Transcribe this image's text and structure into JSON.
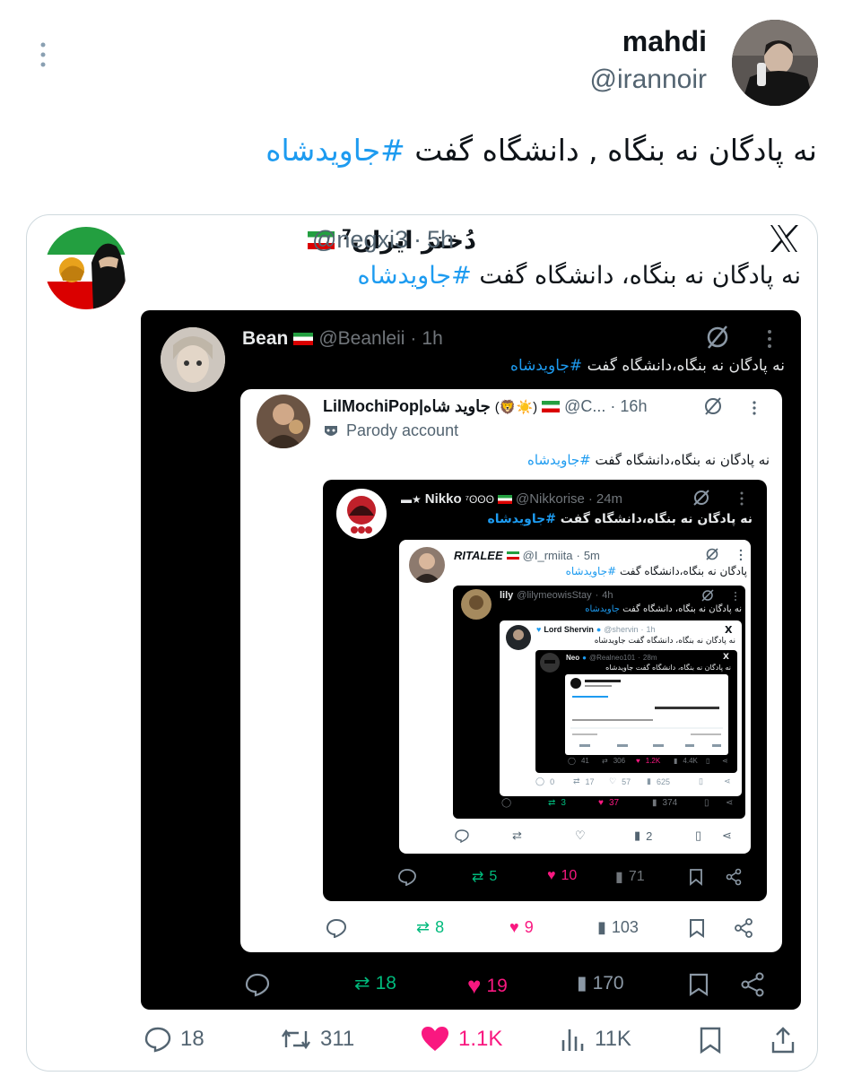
{
  "post": {
    "name": "mahdi",
    "handle": "@irannoir",
    "text": "نه پادگان نه بنگاه , دانشگاه گفت ",
    "hashtag": "#جاویدشاه",
    "stats": {
      "replies": "18",
      "reposts": "311",
      "likes": "1.1K",
      "views": "11K"
    }
  },
  "card": {
    "name": "دُختر ایران",
    "name_sup": "7",
    "handle": "@negxi3",
    "time": "5h",
    "text": "نه پادگان نه بنگاه، دانشگاه گفت ",
    "hashtag": "#جاویدشاه"
  },
  "q1": {
    "name": "Bean",
    "handle": "@Beanleii",
    "time": "1h",
    "text": "نه پادگان نه بنگاه،دانشگاه گفت ",
    "hashtag": "#جاویدشاه",
    "stats": {
      "replies": "",
      "reposts": "18",
      "likes": "19",
      "views": "170"
    }
  },
  "q2": {
    "name": "LilMochiPop|جاوید شاه",
    "handle": "@C...",
    "time": "16h",
    "parody": "Parody account",
    "text": "نه پادگان نه بنگاه،دانشگاه گفت ",
    "hashtag": "#جاویدشاه",
    "stats": {
      "replies": "",
      "reposts": "8",
      "likes": "9",
      "views": "103"
    }
  },
  "q3": {
    "name": "Nikko",
    "handle": "@Nikkorise",
    "time": "24m",
    "text": "نه پادگان نه بنگاه،دانشگاه گفت ",
    "hashtag": "#جاویدشاه",
    "stats": {
      "replies": "",
      "reposts": "5",
      "likes": "10",
      "views": "71"
    }
  },
  "q4": {
    "name": "RITALEE",
    "handle": "@I_rmiita",
    "time": "5m",
    "text": "پادگان نه بنگاه،دانشگاه گفت ",
    "hashtag": "#جاویدشاه",
    "stats": {
      "replies": "",
      "reposts": "",
      "likes": "",
      "views": "2"
    }
  },
  "q5": {
    "name": "lily",
    "handle": "@lilymeowisStay",
    "time": "4h",
    "text": "نه پادگان نه بنگاه، دانشگاه گفت ",
    "hashtag": "جاویدشاه",
    "stats": {
      "replies": "",
      "reposts": "3",
      "likes": "37",
      "views": "374"
    }
  },
  "q6": {
    "name": "Lord Shervin",
    "handle": "@shervin",
    "time": "1h",
    "text": "نه پادگان نه بنگاه، دانشگاه گفت جاویدشاه",
    "stats": {
      "replies": "0",
      "reposts": "17",
      "likes": "57",
      "views": "625"
    }
  },
  "q7": {
    "name": "Neo",
    "handle": "@Realneo101",
    "time": "28m",
    "text": "نه پادگان نه بنگاه، دانشگاه گفت جاویدشاه",
    "stats": {
      "replies": "41",
      "reposts": "306",
      "likes": "1.2K",
      "views": "4.4K"
    }
  },
  "colors": {
    "blue": "#1d9bf0",
    "green": "#00ba7c",
    "pink": "#f91880",
    "dark": "#000000"
  }
}
